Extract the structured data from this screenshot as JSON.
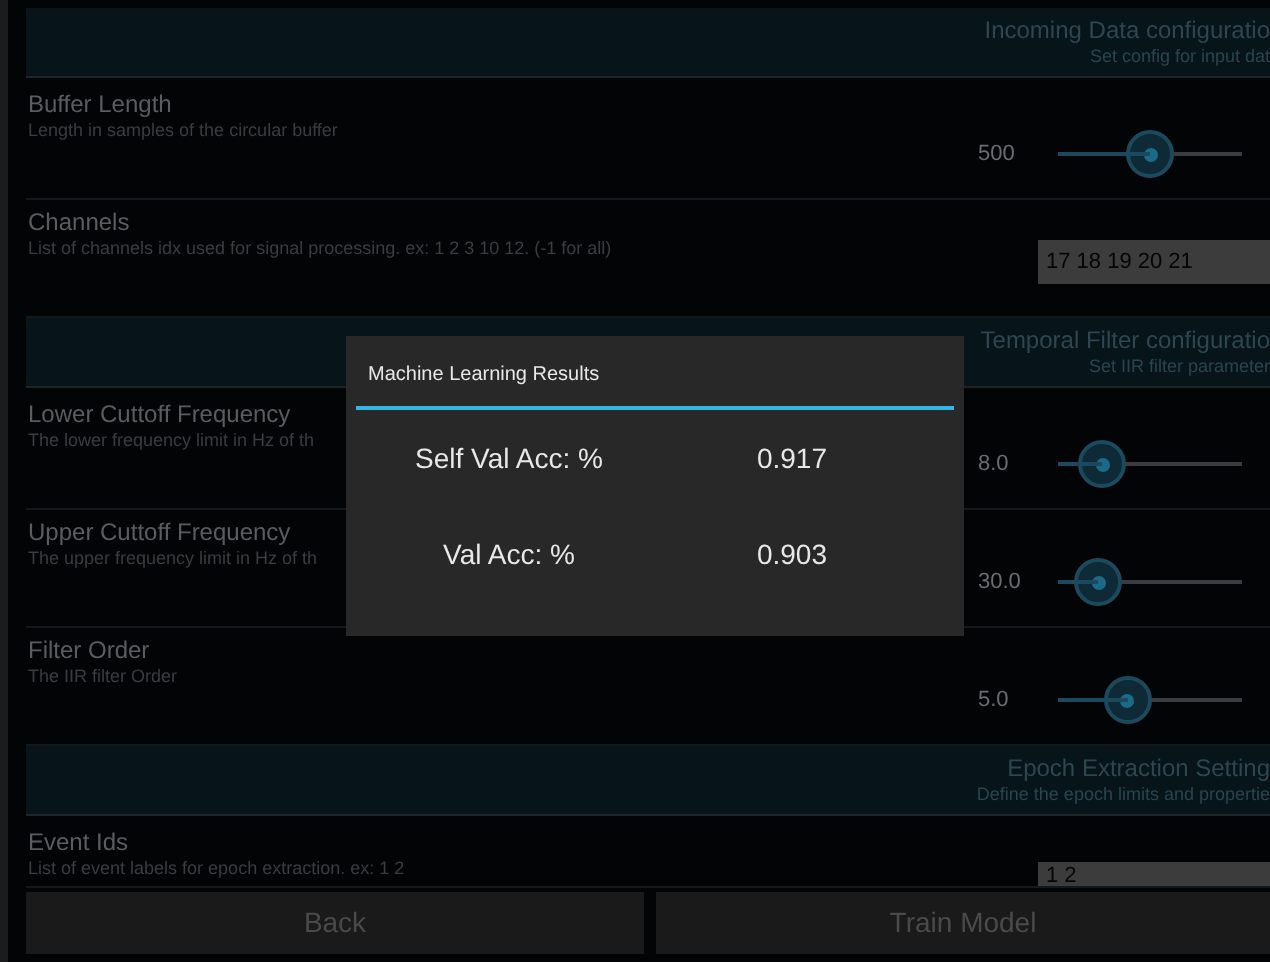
{
  "sections": [
    {
      "title": "Incoming Data configuratio",
      "subtitle": "Set config for input dat",
      "rows": [
        {
          "kind": "slider",
          "label": "Buffer Length",
          "description": "Length in samples of the circular buffer",
          "value": "500",
          "level": 0.5
        },
        {
          "kind": "field",
          "label": "Channels",
          "description": "List of channels idx used for signal processing. ex: 1 2 3 10 12. (-1 for all)",
          "value": "17 18 19 20 21"
        }
      ]
    },
    {
      "title": "Temporal Filter configuratio",
      "subtitle": "Set IIR filter parameter",
      "rows": [
        {
          "kind": "slider",
          "label": "Lower Cuttoff Frequency",
          "description": "The lower frequency limit in Hz of th",
          "value": "8.0",
          "level": 0.24
        },
        {
          "kind": "slider",
          "label": "Upper Cuttoff Frequency",
          "description": "The upper frequency limit in Hz of th",
          "value": "30.0",
          "level": 0.22
        },
        {
          "kind": "slider",
          "label": "Filter Order",
          "description": "The IIR filter Order",
          "value": "5.0",
          "level": 0.38
        }
      ]
    },
    {
      "title": "Epoch Extraction Setting",
      "subtitle": "Define the epoch limits and propertie",
      "rows": [
        {
          "kind": "field",
          "label": "Event Ids",
          "description": "List of event labels for epoch extraction. ex: 1 2",
          "value": "1 2",
          "clipped": true
        }
      ]
    }
  ],
  "buttons": [
    "Back",
    "Train Model"
  ],
  "dialog": {
    "title": "Machine Learning Results",
    "results": [
      {
        "label": "Self Val Acc: %",
        "value": "0.917"
      },
      {
        "label": "Val Acc: %",
        "value": "0.903"
      }
    ]
  }
}
